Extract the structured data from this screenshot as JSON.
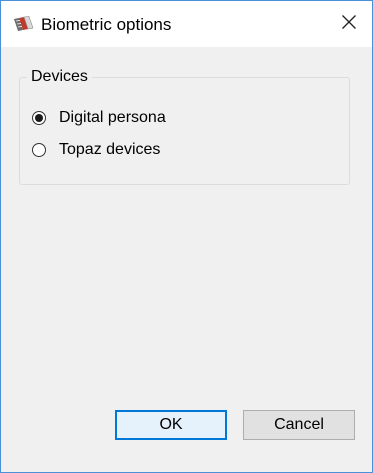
{
  "window": {
    "title": "Biometric options",
    "icon": "biometric-app-icon",
    "close_icon": "close-icon"
  },
  "devices_group": {
    "legend": "Devices",
    "options": [
      {
        "label": "Digital persona",
        "selected": true
      },
      {
        "label": "Topaz devices",
        "selected": false
      }
    ]
  },
  "buttons": {
    "ok_label": "OK",
    "cancel_label": "Cancel"
  },
  "colors": {
    "accent": "#0078d7",
    "window_border": "#4a90d9",
    "dialog_background": "#f0f0f0"
  }
}
